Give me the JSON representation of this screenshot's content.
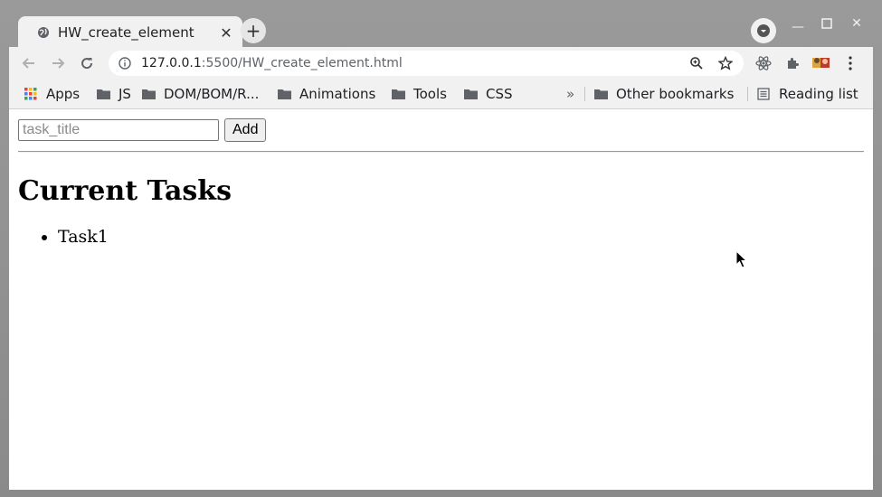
{
  "browser": {
    "tab_title": "HW_create_element",
    "url_host": "127.0.0.1",
    "url_rest": ":5500/HW_create_element.html",
    "bookmarks": [
      {
        "label": "Apps",
        "icon": "apps-grid-icon"
      },
      {
        "label": "JS",
        "icon": "folder-icon"
      },
      {
        "label": "DOM/BOM/R...",
        "icon": "folder-icon"
      },
      {
        "label": "Animations",
        "icon": "folder-icon"
      },
      {
        "label": "Tools",
        "icon": "folder-icon"
      },
      {
        "label": "CSS",
        "icon": "folder-icon"
      }
    ],
    "overflow_label": "»",
    "other_bookmarks": "Other bookmarks",
    "reading_list": "Reading list"
  },
  "page": {
    "input_placeholder": "task_title",
    "add_label": "Add",
    "heading": "Current Tasks",
    "tasks": [
      "Task1"
    ]
  }
}
